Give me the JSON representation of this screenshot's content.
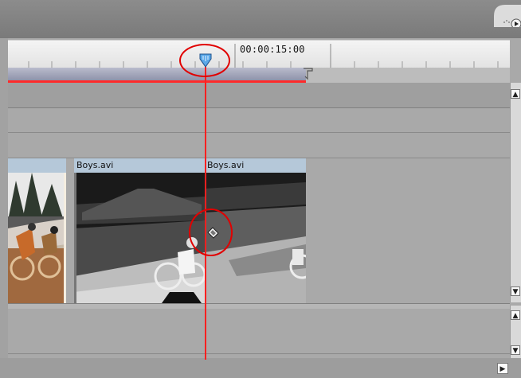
{
  "ruler": {
    "timecode": "00:00:15:00"
  },
  "video_track": {
    "clips": [
      {
        "name": ""
      },
      {
        "name": "Boys.avi"
      },
      {
        "name": "Boys.avi"
      }
    ]
  },
  "icons": {
    "panel_menu": "panel-menu-icon",
    "cti": "current-time-indicator-icon",
    "razor": "razor-cursor-icon",
    "work_area_end": "work-area-end-icon"
  },
  "colors": {
    "playhead": "#ff2020",
    "clip_header": "#b5c8d9",
    "annotation": "#e10000"
  }
}
